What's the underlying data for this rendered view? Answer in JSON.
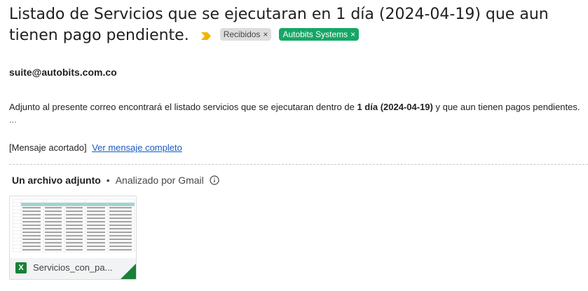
{
  "subject": {
    "title": "Listado de Servicios que se ejecutaran en 1 día (2024-04-19) que aun tienen pago pendiente.",
    "labels": [
      {
        "text": "Recibidos",
        "remove": "×"
      },
      {
        "text": "Autobits Systems",
        "remove": "×"
      }
    ]
  },
  "sender": "suite@autobits.com.co",
  "body": {
    "line_prefix": "Adjunto al presente correo encontrará el listado servicios que se ejecutaran dentro de ",
    "line_bold": "1 día (2024-04-19)",
    "line_suffix": " y que aun tienen pagos pendientes.",
    "ellipsis": "...",
    "truncated": "[Mensaje acortado]",
    "view_full": "Ver mensaje completo"
  },
  "attachments": {
    "count_label": "Un archivo adjunto",
    "separator": "•",
    "scanned": "Analizado por Gmail",
    "file": {
      "name": "Servicios_con_pa...",
      "type_icon": "excel-icon",
      "type_letter": "X"
    }
  },
  "colors": {
    "green_label": "#16a765",
    "gray_label": "#dddddd",
    "link": "#1a5bc4",
    "excel": "#188038",
    "important": "#f2b400"
  }
}
